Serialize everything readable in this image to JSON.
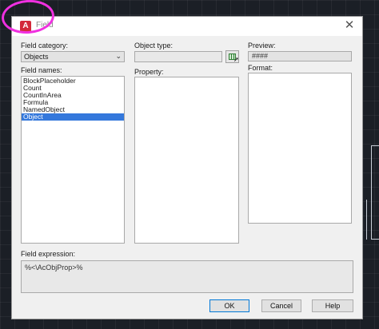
{
  "dialog": {
    "title": "Field",
    "close_icon": "close-icon"
  },
  "left": {
    "category_label": "Field category:",
    "category_value": "Objects",
    "names_label": "Field names:",
    "names": [
      "BlockPlaceholder",
      "Count",
      "CountInArea",
      "Formula",
      "NamedObject",
      "Object"
    ],
    "selected_name": "Object"
  },
  "middle": {
    "object_type_label": "Object type:",
    "object_type_value": "",
    "property_label": "Property:"
  },
  "right": {
    "preview_label": "Preview:",
    "preview_value": "####",
    "format_label": "Format:"
  },
  "expression": {
    "label": "Field expression:",
    "value": "%<\\AcObjProp>%"
  },
  "buttons": {
    "ok": "OK",
    "cancel": "Cancel",
    "help": "Help"
  },
  "colors": {
    "annotation": "#f030e0",
    "selection": "#3478dc",
    "app_icon": "#d3283a"
  }
}
